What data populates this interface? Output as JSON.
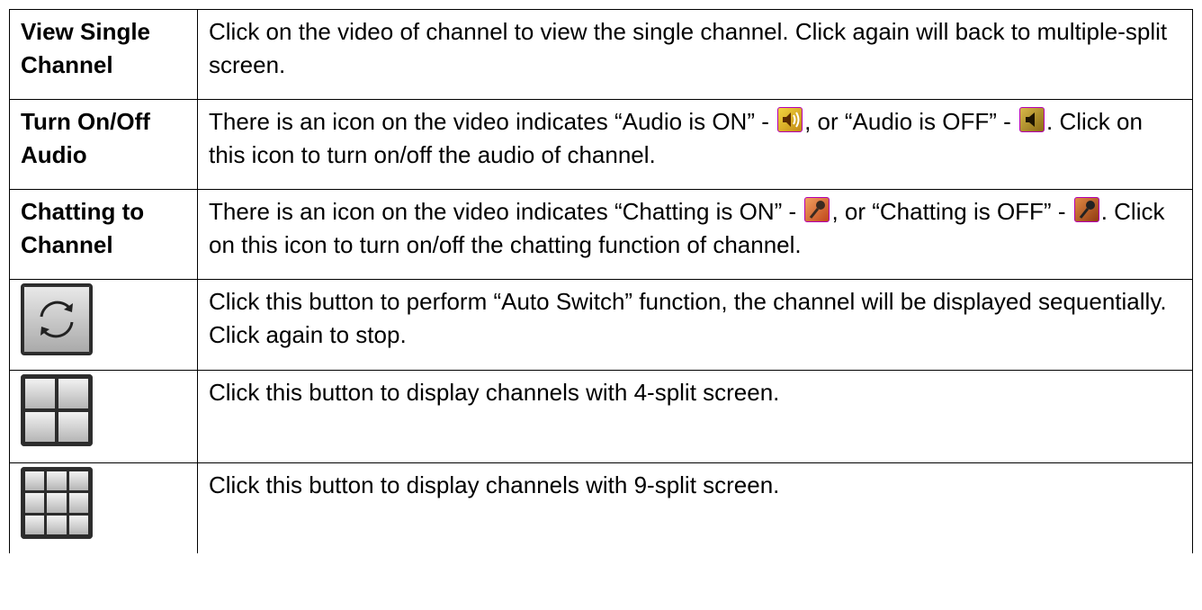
{
  "rows": [
    {
      "label": "View Single Channel",
      "text": "Click on the video of channel to view the single channel. Click again will back to multiple-split screen."
    },
    {
      "label": "Turn On/Off Audio",
      "text_a": "There is an icon on the video indicates “Audio is ON” - ",
      "text_b": ", or “Audio is OFF” - ",
      "text_c": ". Click on this icon to turn on/off the audio of channel.",
      "icon_on": "audio-on-icon",
      "icon_off": "audio-off-icon"
    },
    {
      "label": "Chatting to Channel",
      "text_a": "There is an icon on the video indicates “Chatting is ON” - ",
      "text_b": ", or “Chatting is OFF” - ",
      "text_c": ". Click on this icon to turn on/off the chatting function of channel.",
      "icon_on": "chat-on-icon",
      "icon_off": "chat-off-icon"
    },
    {
      "icon": "auto-switch-icon",
      "text": "Click this button to perform “Auto Switch” function, the channel will be displayed sequentially. Click again to stop."
    },
    {
      "icon": "split-4-icon",
      "text": "Click this button to display channels with 4-split screen."
    },
    {
      "icon": "split-9-icon",
      "text": "Click this button to display channels with 9-split screen."
    }
  ],
  "colors": {
    "border": "#000000",
    "icon_outline": "#b400b4",
    "button_dark": "#2c2c2c"
  }
}
